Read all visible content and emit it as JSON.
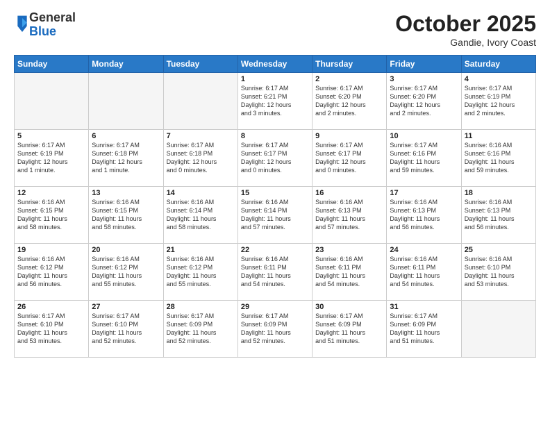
{
  "header": {
    "logo": {
      "general": "General",
      "blue": "Blue"
    },
    "title": "October 2025",
    "subtitle": "Gandie, Ivory Coast"
  },
  "calendar": {
    "days_of_week": [
      "Sunday",
      "Monday",
      "Tuesday",
      "Wednesday",
      "Thursday",
      "Friday",
      "Saturday"
    ],
    "weeks": [
      [
        {
          "day": "",
          "info": ""
        },
        {
          "day": "",
          "info": ""
        },
        {
          "day": "",
          "info": ""
        },
        {
          "day": "1",
          "info": "Sunrise: 6:17 AM\nSunset: 6:21 PM\nDaylight: 12 hours\nand 3 minutes."
        },
        {
          "day": "2",
          "info": "Sunrise: 6:17 AM\nSunset: 6:20 PM\nDaylight: 12 hours\nand 2 minutes."
        },
        {
          "day": "3",
          "info": "Sunrise: 6:17 AM\nSunset: 6:20 PM\nDaylight: 12 hours\nand 2 minutes."
        },
        {
          "day": "4",
          "info": "Sunrise: 6:17 AM\nSunset: 6:19 PM\nDaylight: 12 hours\nand 2 minutes."
        }
      ],
      [
        {
          "day": "5",
          "info": "Sunrise: 6:17 AM\nSunset: 6:19 PM\nDaylight: 12 hours\nand 1 minute."
        },
        {
          "day": "6",
          "info": "Sunrise: 6:17 AM\nSunset: 6:18 PM\nDaylight: 12 hours\nand 1 minute."
        },
        {
          "day": "7",
          "info": "Sunrise: 6:17 AM\nSunset: 6:18 PM\nDaylight: 12 hours\nand 0 minutes."
        },
        {
          "day": "8",
          "info": "Sunrise: 6:17 AM\nSunset: 6:17 PM\nDaylight: 12 hours\nand 0 minutes."
        },
        {
          "day": "9",
          "info": "Sunrise: 6:17 AM\nSunset: 6:17 PM\nDaylight: 12 hours\nand 0 minutes."
        },
        {
          "day": "10",
          "info": "Sunrise: 6:17 AM\nSunset: 6:16 PM\nDaylight: 11 hours\nand 59 minutes."
        },
        {
          "day": "11",
          "info": "Sunrise: 6:16 AM\nSunset: 6:16 PM\nDaylight: 11 hours\nand 59 minutes."
        }
      ],
      [
        {
          "day": "12",
          "info": "Sunrise: 6:16 AM\nSunset: 6:15 PM\nDaylight: 11 hours\nand 58 minutes."
        },
        {
          "day": "13",
          "info": "Sunrise: 6:16 AM\nSunset: 6:15 PM\nDaylight: 11 hours\nand 58 minutes."
        },
        {
          "day": "14",
          "info": "Sunrise: 6:16 AM\nSunset: 6:14 PM\nDaylight: 11 hours\nand 58 minutes."
        },
        {
          "day": "15",
          "info": "Sunrise: 6:16 AM\nSunset: 6:14 PM\nDaylight: 11 hours\nand 57 minutes."
        },
        {
          "day": "16",
          "info": "Sunrise: 6:16 AM\nSunset: 6:13 PM\nDaylight: 11 hours\nand 57 minutes."
        },
        {
          "day": "17",
          "info": "Sunrise: 6:16 AM\nSunset: 6:13 PM\nDaylight: 11 hours\nand 56 minutes."
        },
        {
          "day": "18",
          "info": "Sunrise: 6:16 AM\nSunset: 6:13 PM\nDaylight: 11 hours\nand 56 minutes."
        }
      ],
      [
        {
          "day": "19",
          "info": "Sunrise: 6:16 AM\nSunset: 6:12 PM\nDaylight: 11 hours\nand 56 minutes."
        },
        {
          "day": "20",
          "info": "Sunrise: 6:16 AM\nSunset: 6:12 PM\nDaylight: 11 hours\nand 55 minutes."
        },
        {
          "day": "21",
          "info": "Sunrise: 6:16 AM\nSunset: 6:12 PM\nDaylight: 11 hours\nand 55 minutes."
        },
        {
          "day": "22",
          "info": "Sunrise: 6:16 AM\nSunset: 6:11 PM\nDaylight: 11 hours\nand 54 minutes."
        },
        {
          "day": "23",
          "info": "Sunrise: 6:16 AM\nSunset: 6:11 PM\nDaylight: 11 hours\nand 54 minutes."
        },
        {
          "day": "24",
          "info": "Sunrise: 6:16 AM\nSunset: 6:11 PM\nDaylight: 11 hours\nand 54 minutes."
        },
        {
          "day": "25",
          "info": "Sunrise: 6:16 AM\nSunset: 6:10 PM\nDaylight: 11 hours\nand 53 minutes."
        }
      ],
      [
        {
          "day": "26",
          "info": "Sunrise: 6:17 AM\nSunset: 6:10 PM\nDaylight: 11 hours\nand 53 minutes."
        },
        {
          "day": "27",
          "info": "Sunrise: 6:17 AM\nSunset: 6:10 PM\nDaylight: 11 hours\nand 52 minutes."
        },
        {
          "day": "28",
          "info": "Sunrise: 6:17 AM\nSunset: 6:09 PM\nDaylight: 11 hours\nand 52 minutes."
        },
        {
          "day": "29",
          "info": "Sunrise: 6:17 AM\nSunset: 6:09 PM\nDaylight: 11 hours\nand 52 minutes."
        },
        {
          "day": "30",
          "info": "Sunrise: 6:17 AM\nSunset: 6:09 PM\nDaylight: 11 hours\nand 51 minutes."
        },
        {
          "day": "31",
          "info": "Sunrise: 6:17 AM\nSunset: 6:09 PM\nDaylight: 11 hours\nand 51 minutes."
        },
        {
          "day": "",
          "info": ""
        }
      ]
    ]
  }
}
